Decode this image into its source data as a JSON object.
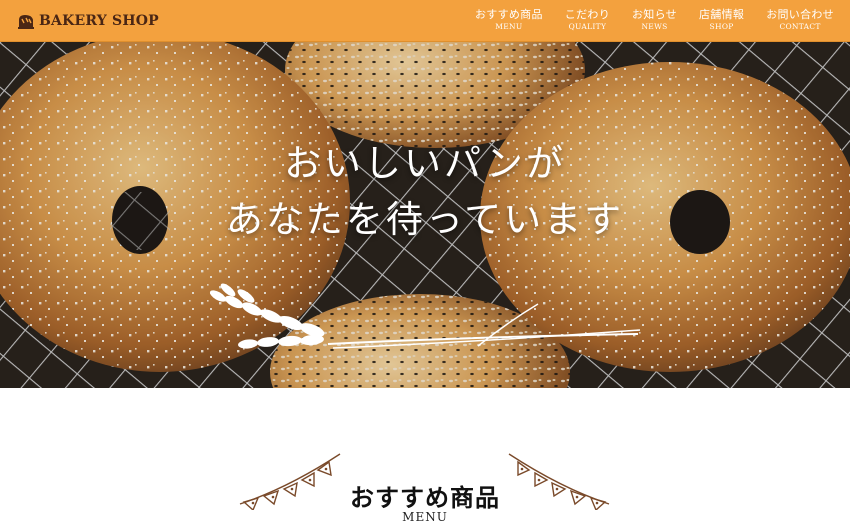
{
  "header": {
    "logo_text": "BAKERY SHOP",
    "logo_icon": "bread-icon",
    "background": "#f3a13e"
  },
  "nav": {
    "items": [
      {
        "jp": "おすすめ商品",
        "en": "MENU"
      },
      {
        "jp": "こだわり",
        "en": "QUALITY"
      },
      {
        "jp": "お知らせ",
        "en": "NEWS"
      },
      {
        "jp": "店舗情報",
        "en": "SHOP"
      },
      {
        "jp": "お問い合わせ",
        "en": "CONTACT"
      }
    ]
  },
  "hero": {
    "line1": "おいしいパンが",
    "line2": "あなたを待っています",
    "decoration_icon": "wheat-icon"
  },
  "section": {
    "title": "おすすめ商品",
    "subtitle": "MENU",
    "decoration_icon": "bunting-icon",
    "bunting_color": "#7a4a2a"
  }
}
